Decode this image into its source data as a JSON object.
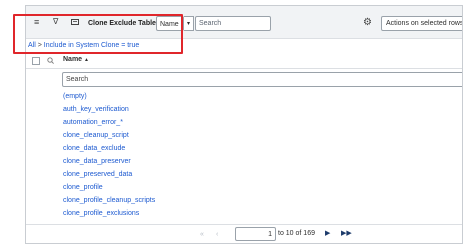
{
  "toolbar": {
    "title": "Clone Exclude Tables",
    "field_select": "Name",
    "search_placeholder": "Search",
    "actions_label": "Actions on selected rows..."
  },
  "breadcrumb": {
    "all": "All",
    "separator": ">",
    "condition": "Include in System Clone = true"
  },
  "table": {
    "column_header": "Name",
    "sort_indicator": "▲",
    "column_search_placeholder": "Search",
    "rows": [
      "(empty)",
      "auth_key_verification",
      "automation_error_*",
      "clone_cleanup_script",
      "clone_data_exclude",
      "clone_data_preserver",
      "clone_preserved_data",
      "clone_profile",
      "clone_profile_cleanup_scripts",
      "clone_profile_exclusions"
    ]
  },
  "pager": {
    "current_page": "1",
    "range_text": "to 10 of 169"
  },
  "icons": {
    "menu": "hamburger-icon",
    "filter": "filter-icon",
    "chat": "comment-icon",
    "settings": "gear-icon",
    "search": "search-icon",
    "first": "first-page-icon",
    "prev": "prev-page-icon",
    "next": "next-page-icon",
    "last": "last-page-icon"
  },
  "colors": {
    "highlight": "#e0262b",
    "link": "#1d5ad0"
  }
}
